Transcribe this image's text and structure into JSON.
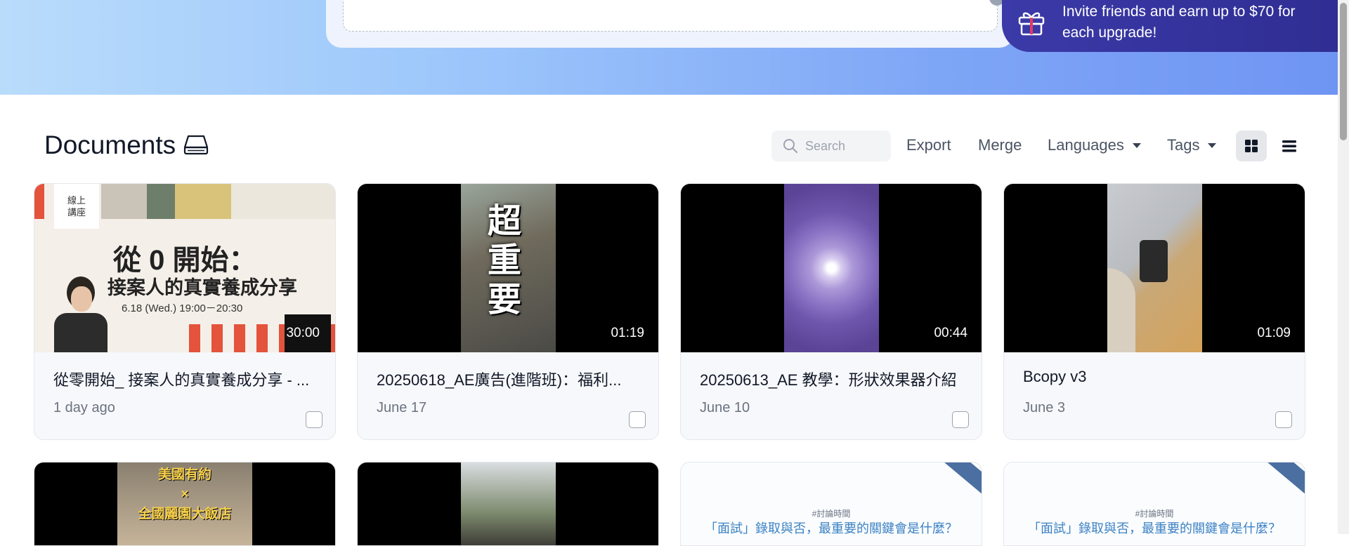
{
  "invite": {
    "text": "Invite friends and earn up to $70 for each upgrade!"
  },
  "toolbar": {
    "title": "Documents",
    "search_placeholder": "Search",
    "export_label": "Export",
    "merge_label": "Merge",
    "languages_label": "Languages",
    "tags_label": "Tags"
  },
  "documents": [
    {
      "title": "從零開始_ 接案人的真實養成分享 - ...",
      "date": "1 day ago",
      "duration": "30:00",
      "thumb": {
        "badge": "線上\n講座",
        "headline": "從 0 開始：",
        "subhead": "接案人的真實養成分享",
        "time": "6.18 (Wed.) 19:00－20:30"
      }
    },
    {
      "title": "20250618_AE廣告(進階班)：福利...",
      "date": "June 17",
      "duration": "01:19",
      "thumb": {
        "text": "超\n重\n要"
      }
    },
    {
      "title": "20250613_AE 教學：形狀效果器介紹",
      "date": "June 10",
      "duration": "00:44"
    },
    {
      "title": "Bcopy v3",
      "date": "June 3",
      "duration": "01:09"
    }
  ],
  "second_row": [
    {
      "thumb_text": "美國有約\n×\n全國麗園大飯店"
    },
    {
      "thumb_text": ""
    },
    {
      "tag": "#討論時間",
      "text": "「面試」錄取與否，最重要的關鍵會是什麼？"
    },
    {
      "tag": "#討論時間",
      "text": "「面試」錄取與否，最重要的關鍵會是什麼？"
    }
  ],
  "colors": {
    "invite_bg": "#3b3aa8",
    "accent_pink": "#e23a64",
    "slide_text": "#3d82c4"
  },
  "icons": [
    "gift-icon",
    "drive-icon",
    "search-icon",
    "grid-view-icon",
    "list-view-icon",
    "caret-down-icon"
  ]
}
